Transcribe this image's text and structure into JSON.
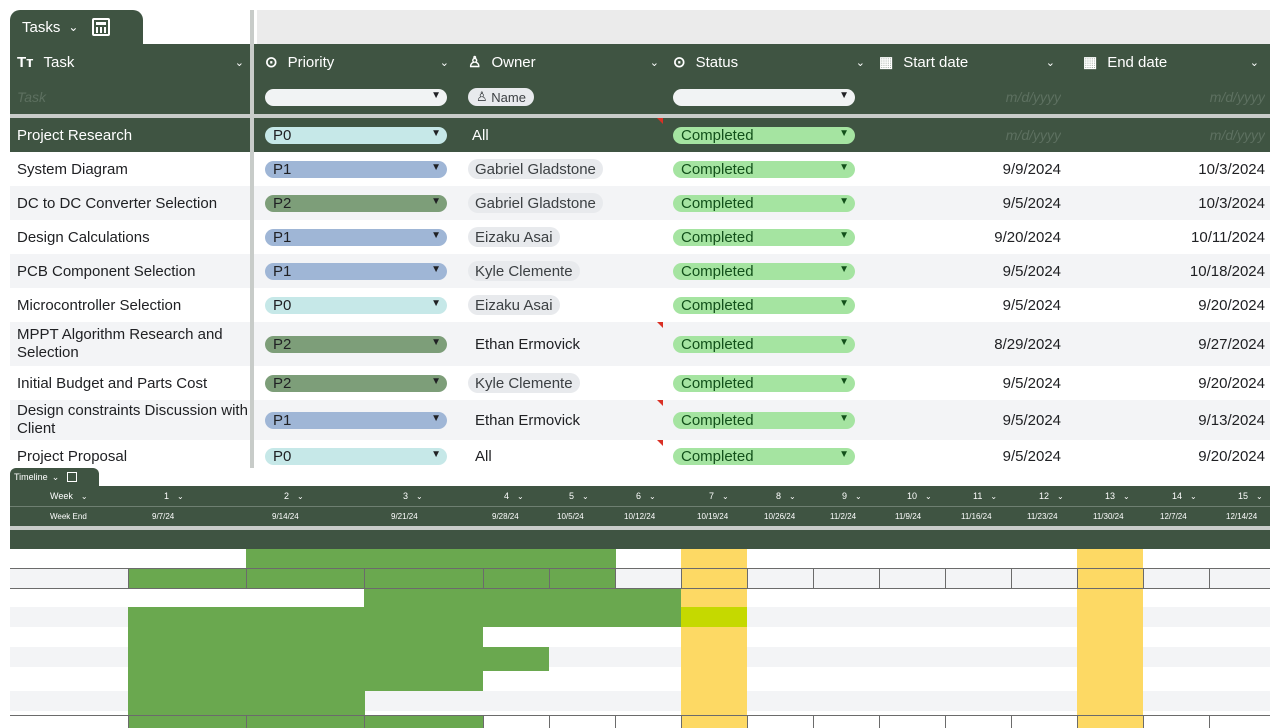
{
  "sheet_tab": {
    "label": "Tasks",
    "chevron_icon": "chevron-down-icon",
    "calc_icon": "calculator-icon"
  },
  "columns": [
    {
      "key": "task",
      "label": "Task",
      "icon": "Tт"
    },
    {
      "key": "priority",
      "label": "Priority",
      "icon": "⊙"
    },
    {
      "key": "owner",
      "label": "Owner",
      "icon": "♙"
    },
    {
      "key": "status",
      "label": "Status",
      "icon": "⊙"
    },
    {
      "key": "start",
      "label": "Start date",
      "icon": "▦"
    },
    {
      "key": "end",
      "label": "End date",
      "icon": "▦"
    }
  ],
  "filter_row": {
    "task_placeholder": "Task",
    "owner_chip": "Name",
    "date_placeholder": "m/d/yyyy"
  },
  "section_row": {
    "task": "Project Research",
    "priority": "P0",
    "owner": "All",
    "status": "Completed",
    "start": "m/d/yyyy",
    "end": "m/d/yyyy"
  },
  "rows": [
    {
      "task": "System Diagram",
      "priority": "P1",
      "owner": "Gabriel Gladstone",
      "status": "Completed",
      "start": "9/9/2024",
      "end": "10/3/2024"
    },
    {
      "task": "DC to DC Converter Selection",
      "priority": "P2",
      "owner": "Gabriel Gladstone",
      "status": "Completed",
      "start": "9/5/2024",
      "end": "10/3/2024"
    },
    {
      "task": "Design Calculations",
      "priority": "P1",
      "owner": "Eizaku Asai",
      "status": "Completed",
      "start": "9/20/2024",
      "end": "10/11/2024"
    },
    {
      "task": "PCB Component Selection",
      "priority": "P1",
      "owner": "Kyle Clemente",
      "status": "Completed",
      "start": "9/5/2024",
      "end": "10/18/2024"
    },
    {
      "task": "Microcontroller Selection",
      "priority": "P0",
      "owner": "Eizaku Asai",
      "status": "Completed",
      "start": "9/5/2024",
      "end": "9/20/2024"
    },
    {
      "task": "MPPT Algorithm Research and Selection",
      "priority": "P2",
      "owner": "Ethan Ermovick",
      "status": "Completed",
      "start": "8/29/2024",
      "end": "9/27/2024"
    },
    {
      "task": "Initial Budget and Parts Cost",
      "priority": "P2",
      "owner": "Kyle Clemente",
      "status": "Completed",
      "start": "9/5/2024",
      "end": "9/20/2024"
    },
    {
      "task": "Design constraints Discussion with Client",
      "priority": "P1",
      "owner": "Ethan Ermovick",
      "status": "Completed",
      "start": "9/5/2024",
      "end": "9/13/2024"
    },
    {
      "task": "Project Proposal",
      "priority": "P0",
      "owner": "All",
      "status": "Completed",
      "start": "9/5/2024",
      "end": "9/20/2024"
    }
  ],
  "priority_colors": {
    "P0": "#c6e8e8",
    "P1": "#9fb6d6",
    "P2": "#7d9e79"
  },
  "status_color": "#a5e4a1",
  "timeline": {
    "tab_label": "Timeline",
    "week_header": "Week",
    "week_end_header": "Week End",
    "weeks": [
      "1",
      "2",
      "3",
      "4",
      "5",
      "6",
      "7",
      "8",
      "9",
      "10",
      "11",
      "12",
      "13",
      "14",
      "15"
    ],
    "week_ends": [
      "9/7/24",
      "9/14/24",
      "9/21/24",
      "9/28/24",
      "10/5/24",
      "10/12/24",
      "10/19/24",
      "10/26/24",
      "11/2/24",
      "11/9/24",
      "11/16/24",
      "11/23/24",
      "11/30/24",
      "12/7/24",
      "12/14/24"
    ],
    "highlight_color": "#fdd964",
    "bar_color": "#6aa84f"
  }
}
